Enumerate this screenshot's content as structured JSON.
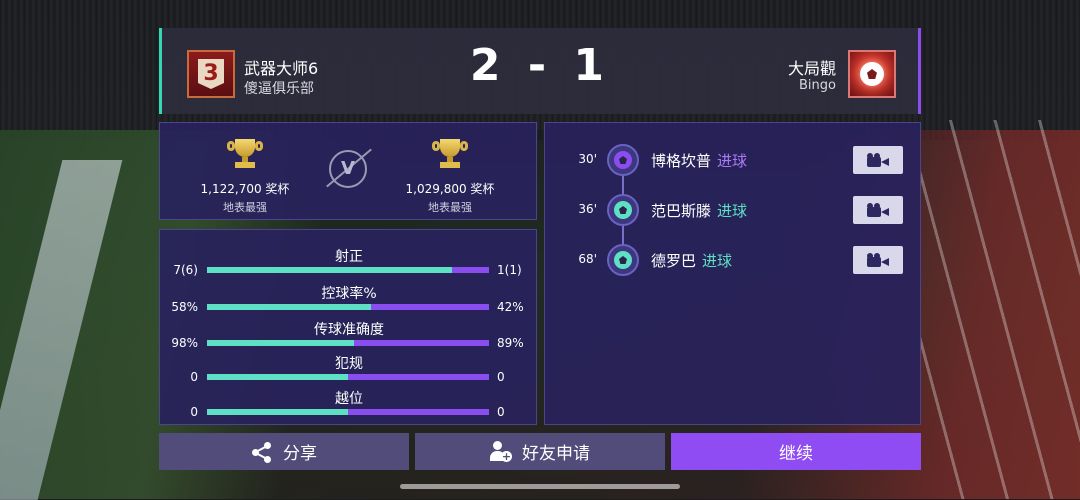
{
  "header": {
    "rank": "3",
    "left_player": "武器大师6",
    "left_club": "傻逼俱乐部",
    "score": "2 - 1",
    "right_player": "大局觀",
    "right_club": "Bingo"
  },
  "trophies": {
    "left_value": "1,122,700 奖杯",
    "left_sub": "地表最强",
    "right_value": "1,029,800 奖杯",
    "right_sub": "地表最强",
    "vs": "V"
  },
  "stats": [
    {
      "label": "射正",
      "left": "7(6)",
      "right": "1(1)",
      "left_share": 0.87
    },
    {
      "label": "控球率%",
      "left": "58%",
      "right": "42%",
      "left_share": 0.58
    },
    {
      "label": "传球准确度",
      "left": "98%",
      "right": "89%",
      "left_share": 0.52
    },
    {
      "label": "犯规",
      "left": "0",
      "right": "0",
      "left_share": 0.5
    },
    {
      "label": "越位",
      "left": "0",
      "right": "0",
      "left_share": 0.5
    }
  ],
  "goals": [
    {
      "minute": "30'",
      "player": "博格坎普",
      "event": "进球",
      "team": "away"
    },
    {
      "minute": "36'",
      "player": "范巴斯滕",
      "event": "进球",
      "team": "home"
    },
    {
      "minute": "68'",
      "player": "德罗巴",
      "event": "进球",
      "team": "home"
    }
  ],
  "buttons": {
    "share": "分享",
    "friend": "好友申请",
    "continue": "继续"
  },
  "colors": {
    "home": "#5ee0c4",
    "away": "#8a4df0",
    "panel": "#28225c",
    "continue": "#8e4cf2"
  }
}
